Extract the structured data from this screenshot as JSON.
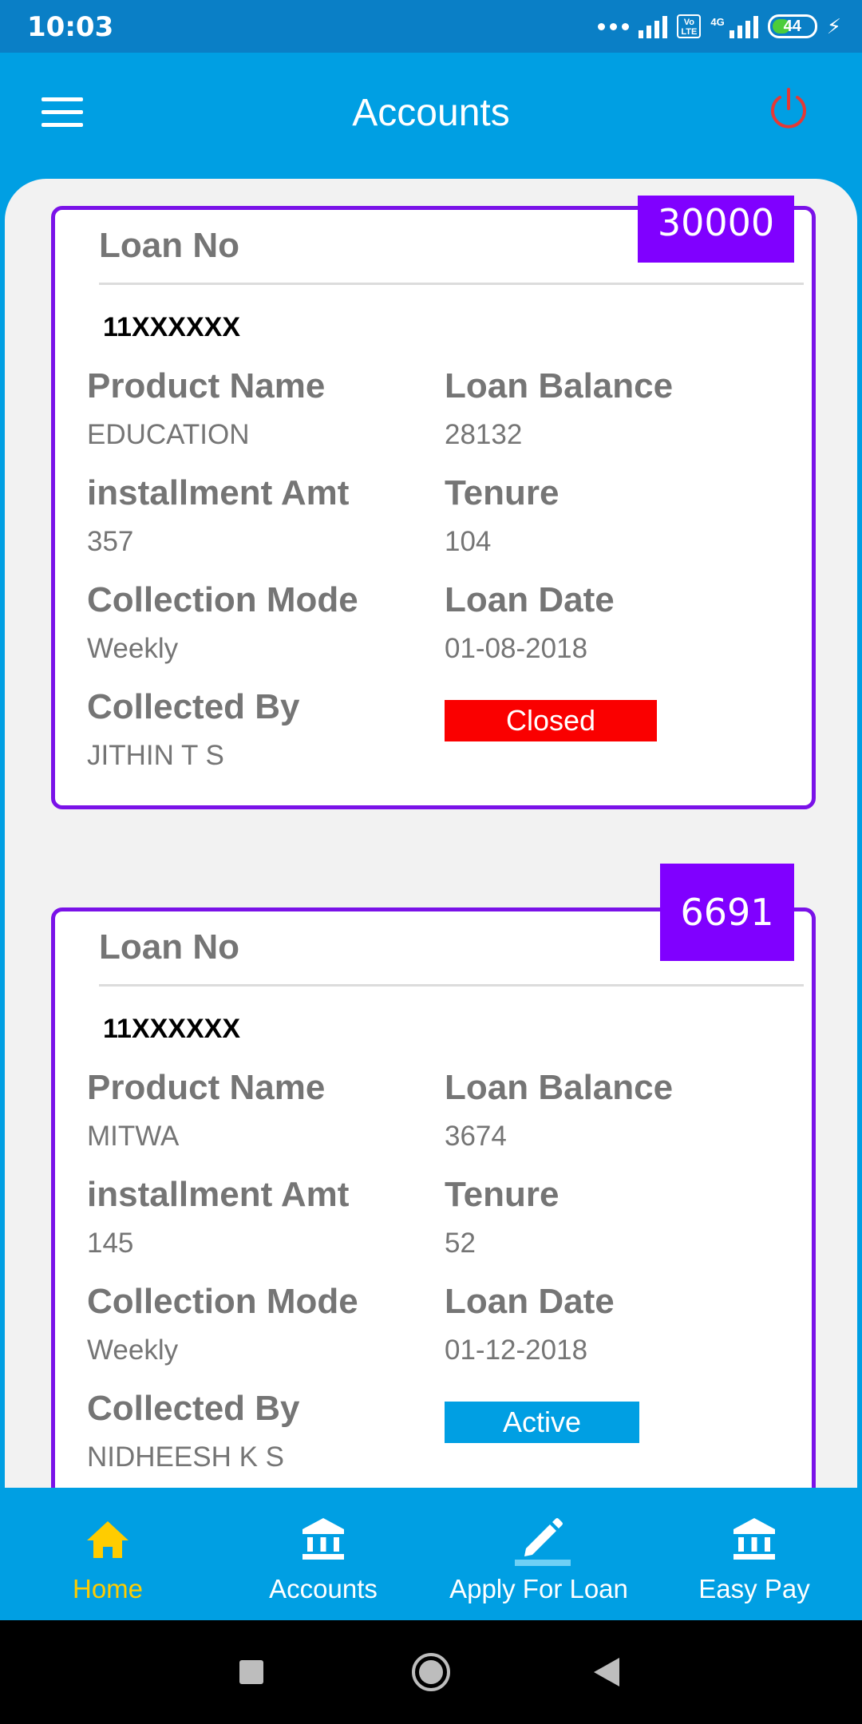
{
  "status_bar": {
    "time": "10:03",
    "network": "4G",
    "volte": "Vo LTE",
    "battery": "44"
  },
  "app_bar": {
    "title": "Accounts",
    "menu_icon": "hamburger-menu-icon",
    "power_icon": "power-icon",
    "power_color": "#e53935"
  },
  "cards": [
    {
      "amount": "30000",
      "loan_no_label": "Loan No",
      "loan_no": "11XXXXXX",
      "product_name_label": "Product Name",
      "product_name": "EDUCATION",
      "loan_balance_label": "Loan Balance",
      "loan_balance": "28132",
      "installment_label": "installment Amt",
      "installment": "357",
      "tenure_label": "Tenure",
      "tenure": "104",
      "collection_mode_label": "Collection Mode",
      "collection_mode": "Weekly",
      "loan_date_label": "Loan Date",
      "loan_date": "01-08-2018",
      "collected_by_label": "Collected By",
      "collected_by": "JITHIN T S",
      "status": "Closed",
      "status_color": "#fa0000"
    },
    {
      "amount": "6691",
      "loan_no_label": "Loan No",
      "loan_no": "11XXXXXX",
      "product_name_label": "Product Name",
      "product_name": "MITWA",
      "loan_balance_label": "Loan Balance",
      "loan_balance": "3674",
      "installment_label": "installment Amt",
      "installment": "145",
      "tenure_label": "Tenure",
      "tenure": "52",
      "collection_mode_label": "Collection Mode",
      "collection_mode": "Weekly",
      "loan_date_label": "Loan Date",
      "loan_date": "01-12-2018",
      "collected_by_label": "Collected By",
      "collected_by": "NIDHEESH K S",
      "status": "Active",
      "status_color": "#009fe3"
    }
  ],
  "colors": {
    "primary": "#009fe3",
    "card_border": "#7a12e8",
    "amount_badge": "#8000ff",
    "active_nav": "#ffcc00"
  },
  "bottom_nav": [
    {
      "label": "Home",
      "icon": "home-icon",
      "active": true
    },
    {
      "label": "Accounts",
      "icon": "bank-icon",
      "active": false
    },
    {
      "label": "Apply For Loan",
      "icon": "pencil-icon",
      "active": false
    },
    {
      "label": "Easy Pay",
      "icon": "bank-icon",
      "active": false
    }
  ],
  "system_nav": {
    "recents_icon": "square-icon",
    "home_icon": "circle-icon",
    "back_icon": "triangle-back-icon"
  }
}
